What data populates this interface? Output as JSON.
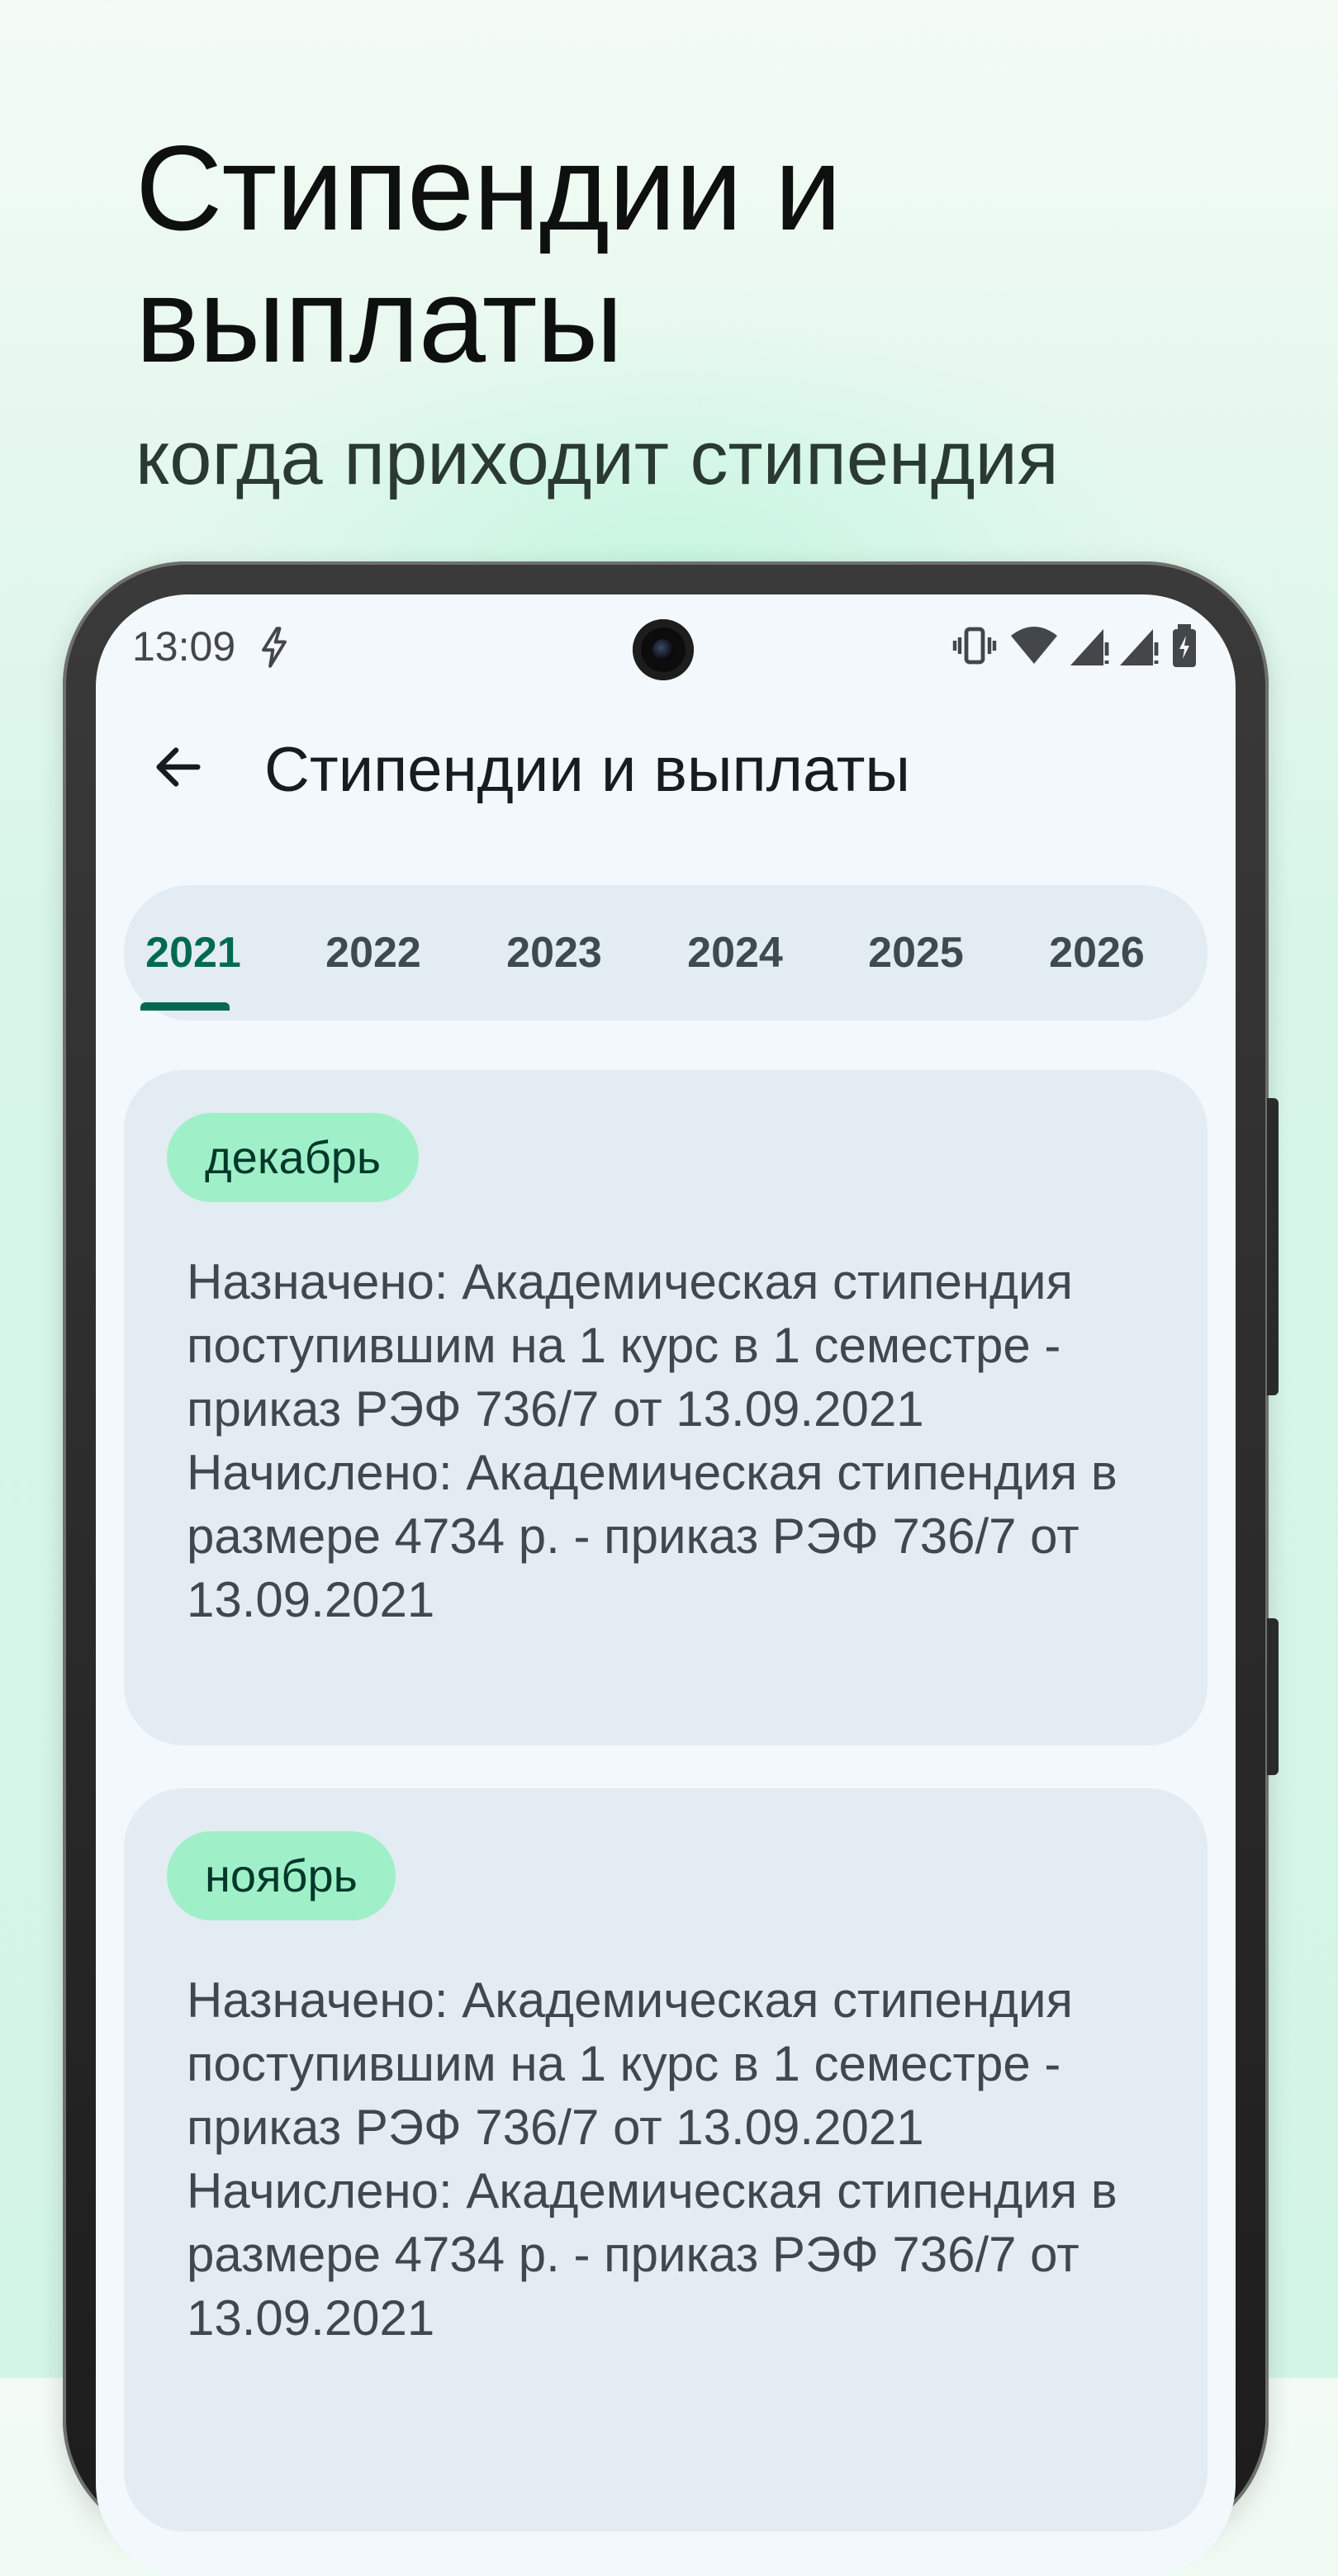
{
  "hero": {
    "title": "Стипендии и выплаты",
    "subtitle": "когда приходит стипендия"
  },
  "status_bar": {
    "time": "13:09",
    "icons": [
      "bolt-icon",
      "vibrate-icon",
      "wifi-icon",
      "signal-icon",
      "signal-icon",
      "battery-icon"
    ]
  },
  "app_bar": {
    "back_icon": "arrow-back-icon",
    "title": "Стипендии и выплаты"
  },
  "tabs": {
    "selected": "2021",
    "items": [
      "2021",
      "2022",
      "2023",
      "2024",
      "2025",
      "2026"
    ]
  },
  "payments": [
    {
      "month": "декабрь",
      "text": "Назначено: Академическая стипендия поступившим на 1 курс в 1 семестре - приказ РЭФ 736/7 от 13.09.2021 Начислено: Академическая стипендия в размере 4734 р. - приказ РЭФ 736/7 от 13.09.2021"
    },
    {
      "month": "ноябрь",
      "text": "Назначено: Академическая стипендия поступившим на 1 курс в 1 семестре - приказ РЭФ 736/7 от 13.09.2021 Начислено: Академическая стипендия в размере 4734 р. - приказ РЭФ 736/7 от 13.09.2021"
    }
  ],
  "colors": {
    "accent": "#006a50",
    "chip": "#9ff0c8",
    "card": "#e2ecf2",
    "background": "#d7f6e7"
  }
}
